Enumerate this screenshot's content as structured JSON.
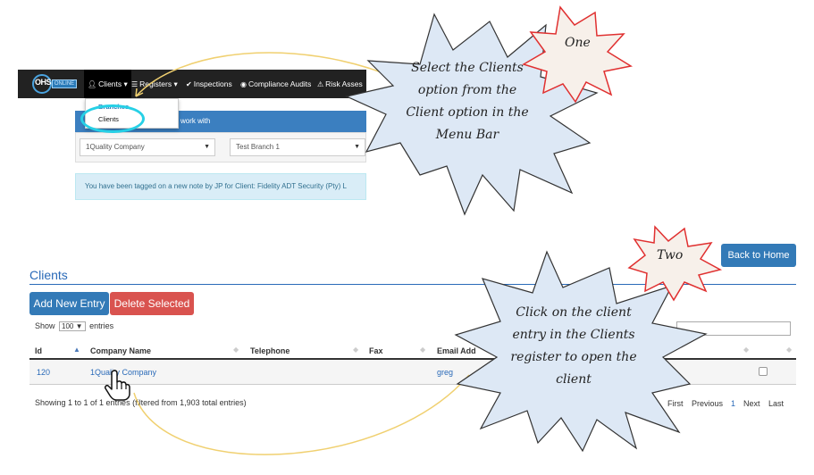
{
  "navbar": {
    "brand_text": "OHS",
    "brand_tag": "ONLINE",
    "items": [
      {
        "label": "Clients",
        "icon": "user-icon",
        "caret": true
      },
      {
        "label": "Registers",
        "icon": "list-icon",
        "caret": true
      },
      {
        "label": "Inspections",
        "icon": "check-icon"
      },
      {
        "label": "Compliance Audits",
        "icon": "eye-icon"
      },
      {
        "label": "Risk Asses",
        "icon": "warning-icon"
      }
    ]
  },
  "dropdown": {
    "items": [
      "Branches",
      "Clients"
    ]
  },
  "panel": {
    "heading": "work with",
    "company_select": "1Quality Company",
    "branch_select": "Test Branch 1"
  },
  "alert_note": "You have been tagged on a new note by JP for Client: Fidelity ADT Security (Pty) L",
  "clients_page": {
    "title": "Clients",
    "buttons": {
      "add": "Add New Entry",
      "delete": "Delete Selected",
      "home": "Back to Home"
    },
    "show_entries": {
      "prefix": "Show",
      "value": "100",
      "suffix": "entries"
    },
    "columns": [
      "Id",
      "Company Name",
      "Telephone",
      "Fax",
      "Email Add"
    ],
    "rows": [
      {
        "id": "120",
        "company": "1Quality Company",
        "email": "greg"
      }
    ],
    "info": "Showing 1 to 1 of 1 entries (filtered from 1,903 total entries)",
    "pagination": [
      "First",
      "Previous",
      "1",
      "Next",
      "Last"
    ]
  },
  "annotations": {
    "step_one_badge": "One",
    "step_one_text": "Select the Clients option from the Client option in the Menu Bar",
    "step_two_badge": "Two",
    "step_two_text": "Click on the client entry in the Clients register to open the client"
  },
  "colors": {
    "navbar": "#222222",
    "panel_heading": "#3b7fc0",
    "primary_button": "#337ab7",
    "danger_button": "#d9534f",
    "callout_fill": "#dde8f5",
    "badge_fill": "#f7f0ea",
    "badge_stroke": "#e03030",
    "highlight_ring": "#26d0e6",
    "connector_line": "#f0d070"
  }
}
